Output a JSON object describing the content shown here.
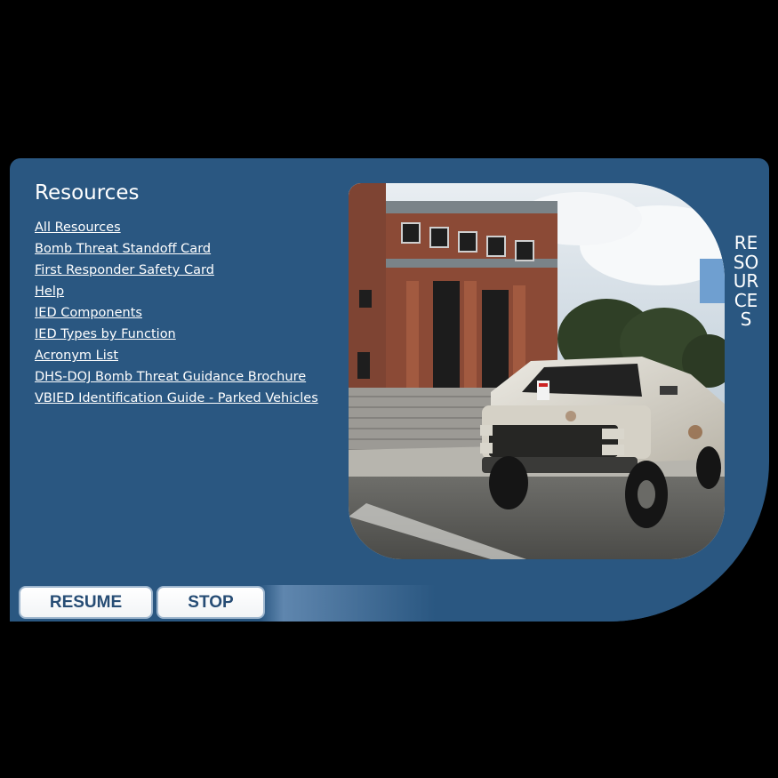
{
  "panel": {
    "title": "Resources",
    "side_tab": "RESOURCES"
  },
  "links": [
    "All Resources",
    "Bomb Threat Standoff Card",
    "First Responder Safety Card",
    "Help",
    "IED Components",
    "IED Types by Function",
    "Acronym List",
    "DHS-DOJ Bomb Threat Guidance Brochure",
    "VBIED Identification Guide - Parked Vehicles"
  ],
  "controls": {
    "resume_label": "RESUME",
    "stop_label": "STOP"
  },
  "colors": {
    "panel_bg": "#2a5781",
    "button_text": "#274d75",
    "page_bg": "#000000"
  },
  "scene": {
    "subject": "white van parked in front of brick building"
  }
}
